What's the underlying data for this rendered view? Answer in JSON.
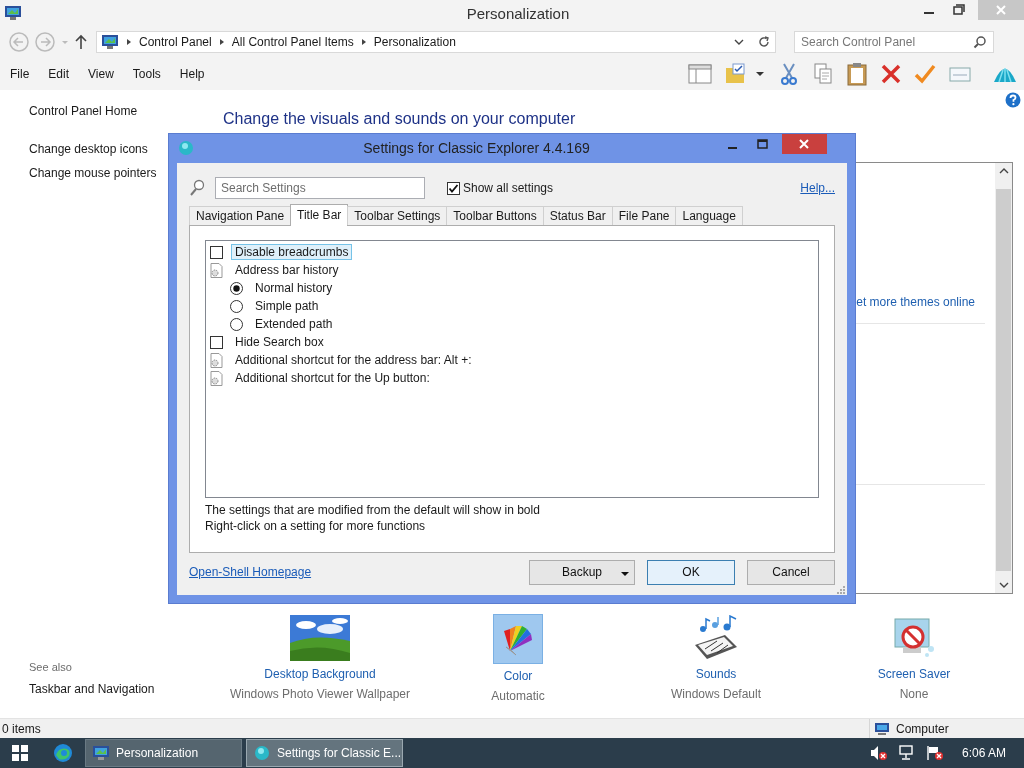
{
  "window": {
    "title": "Personalization"
  },
  "address_bar": {
    "breadcrumbs": [
      "Control Panel",
      "All Control Panel Items",
      "Personalization"
    ]
  },
  "search": {
    "placeholder": "Search Control Panel"
  },
  "menu": [
    "File",
    "Edit",
    "View",
    "Tools",
    "Help"
  ],
  "sidebar": {
    "items": [
      "Control Panel Home",
      "Change desktop icons",
      "Change mouse pointers"
    ],
    "see_also_title": "See also",
    "see_also": [
      "Taskbar and Navigation"
    ]
  },
  "heading": "Change the visuals and sounds on your computer",
  "themes": {
    "link": "et more themes online"
  },
  "items": [
    {
      "kind": "wallpaper",
      "title": "Desktop Background",
      "subtitle": "Windows Photo Viewer Wallpaper",
      "selected": false
    },
    {
      "kind": "color",
      "title": "Color",
      "subtitle": "Automatic",
      "selected": true
    },
    {
      "kind": "sounds",
      "title": "Sounds",
      "subtitle": "Windows Default",
      "selected": false
    },
    {
      "kind": "screensaver",
      "title": "Screen Saver",
      "subtitle": "None",
      "selected": false
    }
  ],
  "status_bar": {
    "count": "0 items",
    "location": "Computer"
  },
  "dialog": {
    "title": "Settings for Classic Explorer 4.4.169",
    "search": {
      "placeholder": "Search Settings"
    },
    "show_all": {
      "label": "Show all settings",
      "checked": true
    },
    "help": "Help...",
    "tabs": [
      {
        "label": "Navigation Pane",
        "selected": false
      },
      {
        "label": "Title Bar",
        "selected": true
      },
      {
        "label": "Toolbar Settings",
        "selected": false
      },
      {
        "label": "Toolbar Buttons",
        "selected": false
      },
      {
        "label": "Status Bar",
        "selected": false
      },
      {
        "label": "File Pane",
        "selected": false
      },
      {
        "label": "Language",
        "selected": false
      }
    ],
    "settings": [
      {
        "kind": "checkbox",
        "label": "Disable breadcrumbs",
        "checked": false,
        "selected": true
      },
      {
        "kind": "group",
        "label": "Address bar history",
        "selected": false,
        "children": [
          {
            "label": "Normal history",
            "selected": true
          },
          {
            "label": "Simple path",
            "selected": false
          },
          {
            "label": "Extended path",
            "selected": false
          }
        ]
      },
      {
        "kind": "checkbox",
        "label": "Hide Search box",
        "checked": false,
        "selected": false
      },
      {
        "kind": "option",
        "label": "Additional shortcut for the address bar: Alt +:",
        "selected": false
      },
      {
        "kind": "option",
        "label": "Additional shortcut for the Up button:",
        "selected": false
      }
    ],
    "notes": [
      "The settings that are modified from the default will show in bold",
      "Right-click on a setting for more functions"
    ],
    "homepage_link": "Open-Shell Homepage",
    "buttons": [
      {
        "kind": "dropdown",
        "label": "Backup"
      },
      {
        "kind": "default",
        "label": "OK"
      },
      {
        "kind": "plain",
        "label": "Cancel"
      }
    ]
  },
  "taskbar": {
    "buttons": [
      {
        "kind": "control-panel",
        "label": "Personalization",
        "selected": false
      },
      {
        "kind": "shell",
        "label": "Settings for Classic E...",
        "selected": true
      }
    ],
    "clock": "6:06 AM"
  }
}
